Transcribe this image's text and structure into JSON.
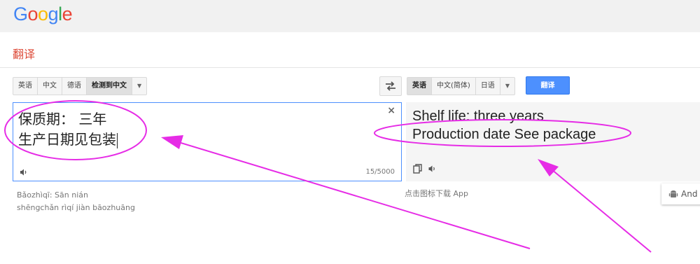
{
  "header": {
    "logo_letters": [
      {
        "ch": "G",
        "color": "#4285f4"
      },
      {
        "ch": "o",
        "color": "#ea4335"
      },
      {
        "ch": "o",
        "color": "#fbbc05"
      },
      {
        "ch": "g",
        "color": "#4285f4"
      },
      {
        "ch": "l",
        "color": "#34a853"
      },
      {
        "ch": "e",
        "color": "#ea4335"
      }
    ],
    "page_title": "翻译"
  },
  "source": {
    "languages": [
      {
        "label": "英语",
        "selected": false
      },
      {
        "label": "中文",
        "selected": false
      },
      {
        "label": "德语",
        "selected": false
      },
      {
        "label": "检测到中文",
        "selected": true
      }
    ],
    "text_line1": "保质期： 三年",
    "text_line2": "生产日期见包装",
    "char_count": "15/5000",
    "clear_symbol": "×",
    "romanization_line1": "Bǎozhìqī: Sān nián",
    "romanization_line2": "shēngchǎn rìqí jiàn bāozhuāng"
  },
  "target": {
    "languages": [
      {
        "label": "英语",
        "selected": true
      },
      {
        "label": "中文(简体)",
        "selected": false
      },
      {
        "label": "日语",
        "selected": false
      }
    ],
    "translate_label": "翻译",
    "text_line1": "Shelf life: three years",
    "text_line2": "Production date See package",
    "app_hint": "点击图标下载 App",
    "android_label": "And"
  },
  "colors": {
    "accent_blue": "#4d90fe",
    "title_red": "#dd4b39",
    "annotation_magenta": "#e62ce6"
  },
  "icons": [
    "swap-icon",
    "speaker-icon",
    "copy-icon",
    "android-icon",
    "dropdown-arrow-icon",
    "close-icon"
  ]
}
